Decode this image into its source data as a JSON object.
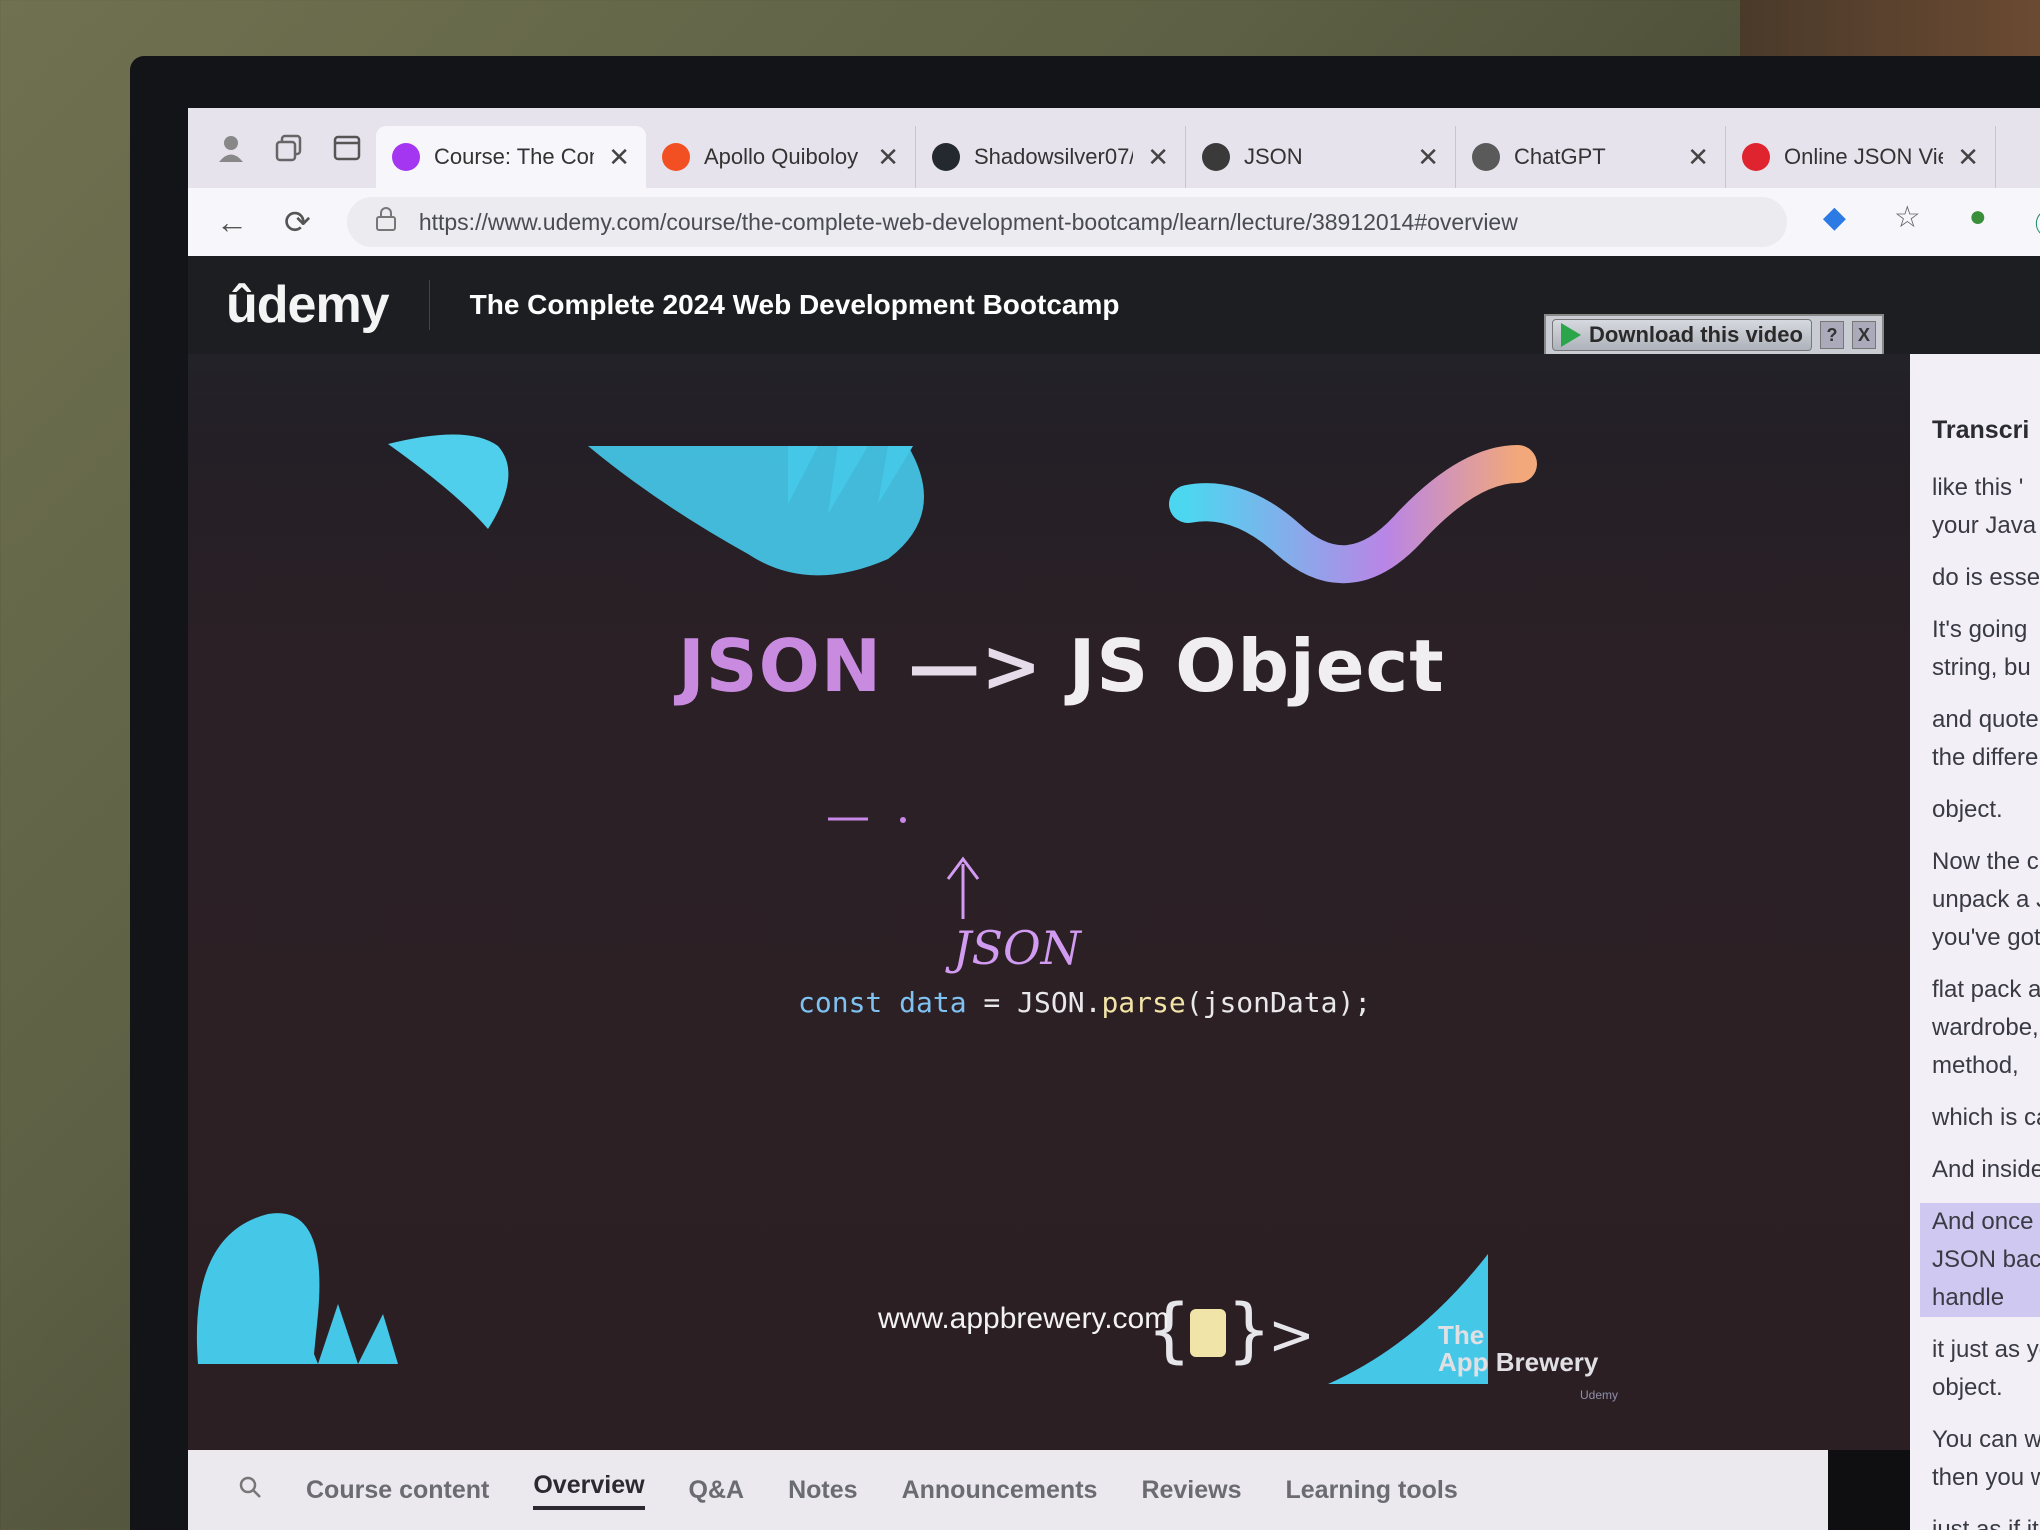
{
  "browser": {
    "tabs": [
      {
        "title": "Course: The Com",
        "icon": "udemy-icon",
        "color": "#a435f0",
        "active": true
      },
      {
        "title": "Apollo Quiboloy",
        "icon": "microsoft-icon",
        "color": "#f25022",
        "active": false
      },
      {
        "title": "Shadowsilver07/",
        "icon": "github-icon",
        "color": "#24292f",
        "active": false
      },
      {
        "title": "JSON",
        "icon": "json-icon",
        "color": "#3a3a3a",
        "active": false
      },
      {
        "title": "ChatGPT",
        "icon": "chatgpt-icon",
        "color": "#5a5a5a",
        "active": false
      },
      {
        "title": "Online JSON Vie",
        "icon": "opera-icon",
        "color": "#e0242f",
        "active": false
      }
    ],
    "close_glyph": "✕",
    "url": "https://www.udemy.com/course/the-complete-web-development-bootcamp/learn/lecture/38912014#overview"
  },
  "header": {
    "logo": "ûdemy",
    "course_title": "The Complete 2024 Web Development Bootcamp",
    "download_label": "Download this video",
    "help_label": "?",
    "close_label": "X"
  },
  "slide": {
    "title_part1": "JSON",
    "title_arrow": " —> ",
    "title_part2": "JS Object",
    "code_kw": "const data",
    "code_eq": " = JSON.",
    "code_fn": "parse",
    "code_rest": "(jsonData);",
    "annotation": "JSON",
    "site": "www.appbrewery.com",
    "brand_line1": "The",
    "brand_line2": "App Brewery",
    "watermark": "Udemy"
  },
  "course_tabs": [
    "Course content",
    "Overview",
    "Q&A",
    "Notes",
    "Announcements",
    "Reviews",
    "Learning tools"
  ],
  "transcript": {
    "heading": "Transcri",
    "lines": [
      [
        "like this '",
        "your Java"
      ],
      [
        "do is esse"
      ],
      [
        "It's going",
        "string, bu"
      ],
      [
        "and quote",
        "the differe"
      ],
      [
        "object."
      ],
      [
        "Now the c",
        "unpack a J",
        "you've got"
      ],
      [
        "flat pack a",
        "wardrobe,",
        "method,"
      ],
      [
        "which is ca"
      ],
      [
        "And inside"
      ],
      [
        "And once y",
        "JSON back",
        "handle"
      ],
      [
        "it just as you",
        "object."
      ],
      [
        "You can writ",
        "then you wo"
      ],
      [
        "just as if it w"
      ]
    ],
    "highlighted_index": 9
  }
}
